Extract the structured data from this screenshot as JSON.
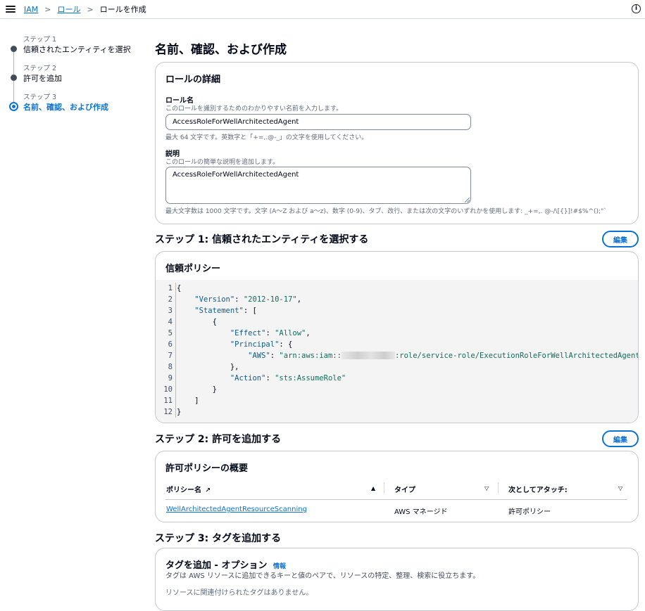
{
  "breadcrumb": {
    "items": [
      "IAM",
      "ロール"
    ],
    "current": "ロールを作成"
  },
  "wizard": {
    "steps": [
      {
        "number": "ステップ 1",
        "title": "信頼されたエンティティを選択"
      },
      {
        "number": "ステップ 2",
        "title": "許可を追加"
      },
      {
        "number": "ステップ 3",
        "title": "名前、確認、および作成"
      }
    ],
    "active_step": 3
  },
  "page_title": "名前、確認、および作成",
  "role_details": {
    "header": "ロールの詳細",
    "name_label": "ロール名",
    "name_desc": "このロールを識別するためのわかりやすい名前を入力します。",
    "name_value": "AccessRoleForWellArchitectedAgent",
    "name_constraint": "最大 64 文字です。英数字と「+=,.@-_」の文字を使用してください。",
    "desc_label": "説明",
    "desc_desc": "このロールの簡単な説明を追加します。",
    "desc_value": "AccessRoleForWellArchitectedAgent",
    "desc_constraint": "最大文字数は 1000 文字です。文字 (A〜Z および a〜z)、数字 (0-9)、タブ、改行、または次の文字のいずれかを使用します: _+=,. @-/\\[{}]!#$%^();\"`"
  },
  "step1": {
    "title": "ステップ 1: 信頼されたエンティティを選択する",
    "edit_label": "編集",
    "card_header": "信頼ポリシー",
    "line_numbers": [
      "1",
      "2",
      "3",
      "4",
      "5",
      "6",
      "7",
      "8",
      "9",
      "10",
      "11",
      "12"
    ],
    "code": {
      "l1": "{",
      "version_key": "\"Version\"",
      "version_val": "\"2012-10-17\"",
      "statement_key": "\"Statement\"",
      "open_bracket": "[",
      "open_brace": "{",
      "effect_key": "\"Effect\"",
      "effect_val": "\"Allow\"",
      "principal_key": "\"Principal\"",
      "aws_key": "\"AWS\"",
      "aws_val_prefix": "\"arn:aws:iam::",
      "aws_val_suffix": ":role/service-role/ExecutionRoleForWellArchitectedAgent\"",
      "close_inner": "},",
      "action_key": "\"Action\"",
      "action_val": "\"sts:AssumeRole\"",
      "close_brace": "}",
      "close_bracket": "]",
      "close_root": "}"
    }
  },
  "step2": {
    "title": "ステップ 2: 許可を追加する",
    "edit_label": "編集",
    "card_header": "許可ポリシーの概要",
    "columns": [
      "ポリシー名",
      "タイプ",
      "次としてアタッチ:"
    ],
    "rows": [
      {
        "name": "WellArchitectedAgentResourceScanning",
        "type": "AWS マネージド",
        "attached_as": "許可ポリシー"
      }
    ]
  },
  "step3": {
    "title": "ステップ 3: タグを追加する",
    "card_header": "タグを追加 - オプション",
    "info_label": "情報",
    "description": "タグは AWS リソースに追加できるキーと値のペアで、リソースの特定、整理、検索に役立ちます。",
    "empty_text": "リソースに関連付けられたタグはありません。"
  },
  "icons": {
    "menu": "hamburger-menu-icon",
    "info": "info-circle-icon",
    "external": "external-link-icon",
    "sort_up": "sort-ascending-icon",
    "sort_down": "sort-descending-icon"
  },
  "colors": {
    "accent": "#0972d3",
    "text": "#000716",
    "muted": "#5f6b7a",
    "border": "#c6c6cd"
  }
}
